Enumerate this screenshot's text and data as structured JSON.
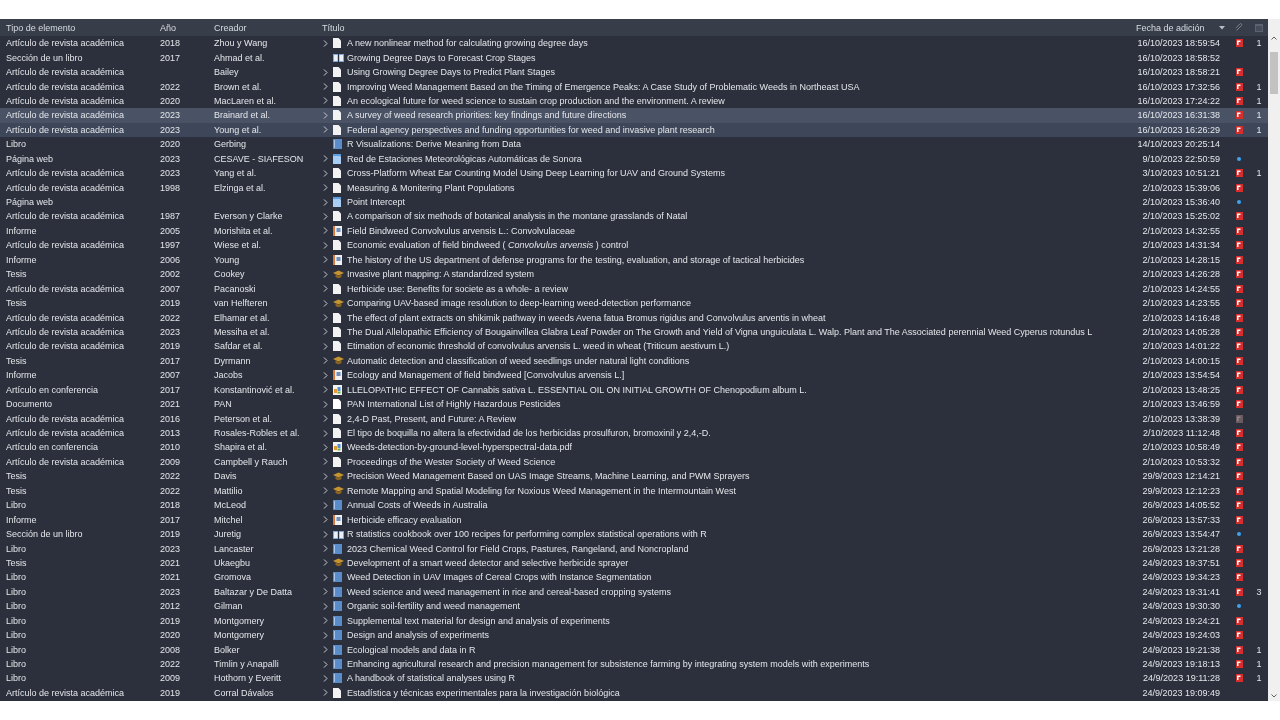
{
  "columns": [
    {
      "label": "Tipo de elemento",
      "sorted": false
    },
    {
      "label": "Año",
      "sorted": false
    },
    {
      "label": "Creador",
      "sorted": false
    },
    {
      "label": "Título",
      "sorted": false
    },
    {
      "label": "Fecha de adición",
      "sorted": true
    }
  ],
  "rows": [
    {
      "item_type": "Artículo de revista académica",
      "year": "2018",
      "creator": "Zhou y Wang",
      "expandable": true,
      "kind": "article",
      "title": "A new nonlinear method for calculating growing degree days",
      "added": "16/10/2023 18:59:54",
      "attachment": {
        "kind": "pdf"
      },
      "notes": "1",
      "selected": false
    },
    {
      "item_type": "Sección de un libro",
      "year": "2017",
      "creator": "Ahmad et al.",
      "expandable": false,
      "kind": "book_section",
      "title": "Growing Degree Days to Forecast Crop Stages",
      "added": "16/10/2023 18:58:52",
      "selected": false
    },
    {
      "item_type": "Artículo de revista académica",
      "creator": "Bailey",
      "expandable": true,
      "kind": "article",
      "title": "Using Growing Degree Days to Predict Plant Stages",
      "added": "16/10/2023 18:58:21",
      "attachment": {
        "kind": "pdf"
      },
      "selected": false
    },
    {
      "item_type": "Artículo de revista académica",
      "year": "2022",
      "creator": "Brown et al.",
      "expandable": true,
      "kind": "article",
      "title": "Improving Weed Management Based on the Timing of Emergence Peaks: A Case Study of Problematic Weeds in Northeast USA",
      "added": "16/10/2023 17:32:56",
      "attachment": {
        "kind": "pdf"
      },
      "notes": "1",
      "selected": false
    },
    {
      "item_type": "Artículo de revista académica",
      "year": "2020",
      "creator": "MacLaren et al.",
      "expandable": true,
      "kind": "article",
      "title": "An ecological future for weed science to sustain crop production and the environment. A review",
      "added": "16/10/2023 17:24:22",
      "attachment": {
        "kind": "pdf"
      },
      "notes": "1",
      "selected": false
    },
    {
      "item_type": "Artículo de revista académica",
      "year": "2023",
      "creator": "Brainard et al.",
      "expandable": true,
      "kind": "article",
      "title": "A survey of weed research priorities: key findings and future directions",
      "added": "16/10/2023 16:31:38",
      "attachment": {
        "kind": "pdf"
      },
      "notes": "1",
      "selected": true
    },
    {
      "item_type": "Artículo de revista académica",
      "year": "2023",
      "creator": "Young et al.",
      "expandable": true,
      "kind": "article",
      "title": "Federal agency perspectives and funding opportunities for weed and invasive plant research",
      "added": "16/10/2023 16:26:29",
      "attachment": {
        "kind": "pdf"
      },
      "notes": "1",
      "selected": true
    },
    {
      "item_type": "Libro",
      "year": "2020",
      "creator": "Gerbing",
      "expandable": false,
      "kind": "book",
      "title": "R Visualizations: Derive Meaning from Data",
      "added": "14/10/2023 20:25:14",
      "selected": false
    },
    {
      "item_type": "Página web",
      "year": "2023",
      "creator": "CESAVE - SIAFESON",
      "expandable": true,
      "kind": "webpage",
      "title": "Red de Estaciones Meteorológicas Automáticas de Sonora",
      "added": "9/10/2023 22:50:59",
      "attachment": {
        "kind": "link"
      },
      "selected": false
    },
    {
      "item_type": "Artículo de revista académica",
      "year": "2023",
      "creator": "Yang et al.",
      "expandable": true,
      "kind": "article",
      "title": "Cross-Platform Wheat Ear Counting Model Using Deep Learning for UAV and Ground Systems",
      "added": "3/10/2023 10:51:21",
      "attachment": {
        "kind": "pdf"
      },
      "notes": "1",
      "selected": false
    },
    {
      "item_type": "Artículo de revista académica",
      "year": "1998",
      "creator": "Elzinga et al.",
      "expandable": true,
      "kind": "article",
      "title": "Measuring & Monitering Plant Populations",
      "added": "2/10/2023 15:39:06",
      "attachment": {
        "kind": "pdf"
      },
      "selected": false
    },
    {
      "item_type": "Página web",
      "expandable": true,
      "kind": "webpage",
      "title": "Point Intercept",
      "added": "2/10/2023 15:36:40",
      "attachment": {
        "kind": "link"
      },
      "selected": false
    },
    {
      "item_type": "Artículo de revista académica",
      "year": "1987",
      "creator": "Everson y Clarke",
      "expandable": true,
      "kind": "article",
      "title": "A comparison of six methods of botanical analysis in the montane grasslands of Natal",
      "added": "2/10/2023 15:25:02",
      "attachment": {
        "kind": "pdf"
      },
      "selected": false
    },
    {
      "item_type": "Informe",
      "year": "2005",
      "creator": "Morishita et al.",
      "expandable": true,
      "kind": "report",
      "title": "Field Bindweed Convolvulus arvensis L.: Convolvulaceae",
      "added": "2/10/2023 14:32:55",
      "attachment": {
        "kind": "pdf"
      },
      "selected": false
    },
    {
      "item_type": "Artículo de revista académica",
      "year": "1997",
      "creator": "Wiese et al.",
      "expandable": true,
      "kind": "article",
      "title": "Economic evaluation of field bindweed ( *Convolvulus arvensis* ) control",
      "added": "2/10/2023 14:31:34",
      "attachment": {
        "kind": "pdf"
      },
      "selected": false
    },
    {
      "item_type": "Informe",
      "year": "2006",
      "creator": "Young",
      "expandable": true,
      "kind": "report",
      "title": "The history of the US department of defense programs for the testing, evaluation, and storage of tactical herbicides",
      "added": "2/10/2023 14:28:15",
      "attachment": {
        "kind": "pdf"
      },
      "selected": false
    },
    {
      "item_type": "Tesis",
      "year": "2002",
      "creator": "Cookey",
      "expandable": true,
      "kind": "thesis",
      "title": "Invasive plant mapping: A standardized system",
      "added": "2/10/2023 14:26:28",
      "attachment": {
        "kind": "pdf"
      },
      "selected": false
    },
    {
      "item_type": "Artículo de revista académica",
      "year": "2007",
      "creator": "Pacanoski",
      "expandable": true,
      "kind": "article",
      "title": "Herbicide use: Benefits for societe as a whole- a review",
      "added": "2/10/2023 14:24:55",
      "attachment": {
        "kind": "pdf"
      },
      "selected": false
    },
    {
      "item_type": "Tesis",
      "year": "2019",
      "creator": "van Helfteren",
      "expandable": true,
      "kind": "thesis",
      "title": "Comparing UAV-based image resolution to deep-learning weed-detection performance",
      "added": "2/10/2023 14:23:55",
      "attachment": {
        "kind": "pdf"
      },
      "selected": false
    },
    {
      "item_type": "Artículo de revista académica",
      "year": "2022",
      "creator": "Elhamar et al.",
      "expandable": true,
      "kind": "article",
      "title": "The effect of plant extracts on shikimik pathway in weeds Avena fatua Bromus rigidus and Convolvulus arventis in wheat",
      "added": "2/10/2023 14:16:48",
      "attachment": {
        "kind": "pdf"
      },
      "selected": false
    },
    {
      "item_type": "Artículo de revista académica",
      "year": "2023",
      "creator": "Messiha et al.",
      "expandable": true,
      "kind": "article",
      "title": "The Dual Allelopathic Efficiency of Bougainvillea Glabra Leaf Powder on The Growth and Yield of Vigna unguiculata L. Walp. Plant and The Associated perennial Weed Cyperus rotundus L",
      "added": "2/10/2023 14:05:28",
      "attachment": {
        "kind": "pdf"
      },
      "selected": false
    },
    {
      "item_type": "Artículo de revista académica",
      "year": "2019",
      "creator": "Safdar et al.",
      "expandable": true,
      "kind": "article",
      "title": "Etimation of economic threshold of convolvulus arvensis L. weed in wheat (Triticum aestivum L.)",
      "added": "2/10/2023 14:01:22",
      "attachment": {
        "kind": "pdf"
      },
      "selected": false
    },
    {
      "item_type": "Tesis",
      "year": "2017",
      "creator": "Dyrmann",
      "expandable": true,
      "kind": "thesis",
      "title": "Automatic detection and classification of weed seedlings under natural light conditions",
      "added": "2/10/2023 14:00:15",
      "attachment": {
        "kind": "pdf"
      },
      "selected": false
    },
    {
      "item_type": "Informe",
      "year": "2007",
      "creator": "Jacobs",
      "expandable": true,
      "kind": "report",
      "title": "Ecology and Management of field bindweed [Convolvulus arvensis L.]",
      "added": "2/10/2023 13:54:54",
      "attachment": {
        "kind": "pdf"
      },
      "selected": false
    },
    {
      "item_type": "Artículo en conferencia",
      "year": "2017",
      "creator": "Konstantinović et al.",
      "expandable": true,
      "kind": "conference",
      "title": "LLELOPATHIC EFFECT OF Cannabis sativa L. ESSENTIAL OIL ON INITIAL GROWTH OF Chenopodium album L.",
      "added": "2/10/2023 13:48:25",
      "attachment": {
        "kind": "pdf"
      },
      "selected": false
    },
    {
      "item_type": "Documento",
      "year": "2021",
      "creator": "PAN",
      "expandable": true,
      "kind": "document",
      "title": "PAN International List of Highly Hazardous Pesticides",
      "added": "2/10/2023 13:46:59",
      "attachment": {
        "kind": "pdf"
      },
      "selected": false
    },
    {
      "item_type": "Artículo de revista académica",
      "year": "2016",
      "creator": "Peterson et al.",
      "expandable": true,
      "kind": "article",
      "title": "2,4-D Past, Present, and Future: A Review",
      "added": "2/10/2023 13:38:39",
      "attachment": {
        "kind": "pdf_missing"
      },
      "selected": false
    },
    {
      "item_type": "Artículo de revista académica",
      "year": "2013",
      "creator": "Rosales-Robles et al.",
      "expandable": true,
      "kind": "article",
      "title": "El tipo de boquilla no altera la efectividad de los herbicidas prosulfuron, bromoxinil y 2,4,-D.",
      "added": "2/10/2023 11:12:48",
      "attachment": {
        "kind": "pdf"
      },
      "selected": false
    },
    {
      "item_type": "Artículo en conferencia",
      "year": "2010",
      "creator": "Shapira et al.",
      "expandable": true,
      "kind": "conference",
      "title": "Weeds-detection-by-ground-level-hyperspectral-data.pdf",
      "added": "2/10/2023 10:58:49",
      "attachment": {
        "kind": "pdf"
      },
      "selected": false
    },
    {
      "item_type": "Artículo de revista académica",
      "year": "2009",
      "creator": "Campbell y Rauch",
      "expandable": true,
      "kind": "article",
      "title": "Proceedings of the Wester Society of Weed Science",
      "added": "2/10/2023 10:53:32",
      "attachment": {
        "kind": "pdf"
      },
      "selected": false
    },
    {
      "item_type": "Tesis",
      "year": "2022",
      "creator": "Davis",
      "expandable": true,
      "kind": "thesis",
      "title": "Precision Weed Management Based on UAS Image Streams, Machine Learning, and PWM Sprayers",
      "added": "29/9/2023 12:14:21",
      "attachment": {
        "kind": "pdf"
      },
      "selected": false
    },
    {
      "item_type": "Tesis",
      "year": "2022",
      "creator": "Mattilio",
      "expandable": true,
      "kind": "thesis",
      "title": "Remote Mapping and Spatial Modeling for Noxious Weed Management in the Intermountain West",
      "added": "29/9/2023 12:12:23",
      "attachment": {
        "kind": "pdf"
      },
      "selected": false
    },
    {
      "item_type": "Libro",
      "year": "2018",
      "creator": "McLeod",
      "expandable": true,
      "kind": "book",
      "title": "Annual Costs of Weeds in Australia",
      "added": "26/9/2023 14:05:52",
      "attachment": {
        "kind": "pdf"
      },
      "selected": false
    },
    {
      "item_type": "Informe",
      "year": "2017",
      "creator": "Mitchel",
      "expandable": true,
      "kind": "report",
      "title": "Herbicide efficacy evaluation",
      "added": "26/9/2023 13:57:33",
      "attachment": {
        "kind": "pdf"
      },
      "selected": false
    },
    {
      "item_type": "Sección de un libro",
      "year": "2019",
      "creator": "Juretig",
      "expandable": true,
      "kind": "book_section",
      "title": "R statistics cookbook over 100 recipes for performing complex statistical operations with R",
      "added": "26/9/2023 13:54:47",
      "attachment": {
        "kind": "link"
      },
      "selected": false
    },
    {
      "item_type": "Libro",
      "year": "2023",
      "creator": "Lancaster",
      "expandable": true,
      "kind": "book",
      "title": "2023 Chemical Weed Control for Field Crops, Pastures, Rangeland, and Noncropland",
      "added": "26/9/2023 13:21:28",
      "attachment": {
        "kind": "pdf"
      },
      "selected": false
    },
    {
      "item_type": "Tesis",
      "year": "2021",
      "creator": "Ukaegbu",
      "expandable": true,
      "kind": "thesis",
      "title": "Development of a smart weed detector and selective herbicide sprayer",
      "added": "24/9/2023 19:37:51",
      "attachment": {
        "kind": "pdf"
      },
      "selected": false
    },
    {
      "item_type": "Libro",
      "year": "2021",
      "creator": "Gromova",
      "expandable": true,
      "kind": "book",
      "title": "Weed Detection in UAV Images of Cereal Crops with Instance Segmentation",
      "added": "24/9/2023 19:34:23",
      "attachment": {
        "kind": "pdf"
      },
      "selected": false
    },
    {
      "item_type": "Libro",
      "year": "2023",
      "creator": "Baltazar y De Datta",
      "expandable": true,
      "kind": "book",
      "title": "Weed science and weed management in rice and cereal-based cropping systems",
      "added": "24/9/2023 19:31:41",
      "attachment": {
        "kind": "pdf"
      },
      "notes": "3",
      "selected": false
    },
    {
      "item_type": "Libro",
      "year": "2012",
      "creator": "Gilman",
      "expandable": true,
      "kind": "book",
      "title": "Organic soil-fertility and weed management",
      "added": "24/9/2023 19:30:30",
      "attachment": {
        "kind": "link"
      },
      "selected": false
    },
    {
      "item_type": "Libro",
      "year": "2019",
      "creator": "Montgomery",
      "expandable": true,
      "kind": "book",
      "title": "Supplemental text material for design and analysis of experiments",
      "added": "24/9/2023 19:24:21",
      "attachment": {
        "kind": "pdf"
      },
      "selected": false
    },
    {
      "item_type": "Libro",
      "year": "2020",
      "creator": "Montgomery",
      "expandable": true,
      "kind": "book",
      "title": "Design and analysis of experiments",
      "added": "24/9/2023 19:24:03",
      "attachment": {
        "kind": "pdf"
      },
      "selected": false
    },
    {
      "item_type": "Libro",
      "year": "2008",
      "creator": "Bolker",
      "expandable": true,
      "kind": "book",
      "title": "Ecological models and data in R",
      "added": "24/9/2023 19:21:38",
      "attachment": {
        "kind": "pdf"
      },
      "notes": "1",
      "selected": false
    },
    {
      "item_type": "Libro",
      "year": "2022",
      "creator": "Timlin y Anapalli",
      "expandable": true,
      "kind": "book",
      "title": "Enhancing agricultural research and precision management for subsistence farming by integrating system models with experiments",
      "added": "24/9/2023 19:18:13",
      "attachment": {
        "kind": "pdf"
      },
      "notes": "1",
      "selected": false
    },
    {
      "item_type": "Libro",
      "year": "2009",
      "creator": "Hothorn y Everitt",
      "expandable": true,
      "kind": "book",
      "title": "A handbook of statistical analyses using R",
      "added": "24/9/2023 19:11:28",
      "attachment": {
        "kind": "pdf"
      },
      "notes": "1",
      "selected": false
    },
    {
      "item_type": "Artículo de revista académica",
      "year": "2019",
      "creator": "Corral Dávalos",
      "expandable": true,
      "kind": "article",
      "title": "Estadística y técnicas experimentales para la investigación biológica",
      "added": "24/9/2023 19:09:49",
      "selected": false
    }
  ]
}
